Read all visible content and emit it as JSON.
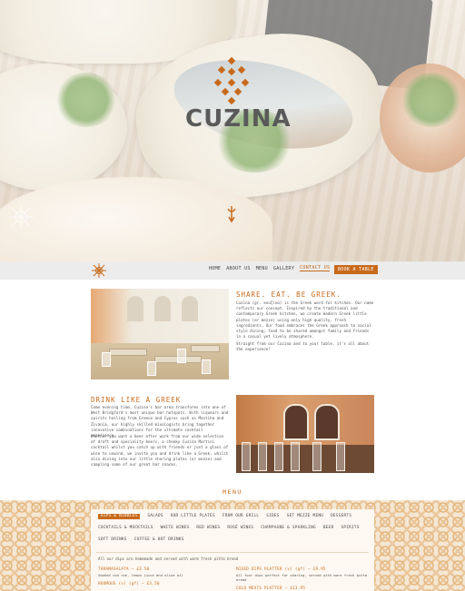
{
  "hero": {
    "brand": "CUZINA"
  },
  "nav": {
    "items": [
      "HOME",
      "ABOUT US",
      "MENU",
      "GALLERY",
      "CONTACT US"
    ],
    "active": "CONTACT US",
    "book_button": "BOOK A TABLE"
  },
  "about": {
    "title": "SHARE. EAT. BE GREEK.",
    "p1": "Cuzina (gr. κουζίνα) is the Greek word for kitchen. Our name reflects our concept. Inspired by the traditional and contemporary Greek kitchen, we create modern Greek little plates (or mezze) using only high quality, fresh ingredients. Our food embraces the Greek approach to social style dining; food to be shared amongst family and friends in a casual yet lively atmosphere.",
    "p2": "Straight from our Cuzina and to your table, it's all about the experience!"
  },
  "drink": {
    "title": "DRINK LIKE A GREEK",
    "p1": "Come evening time, Cuzina's bar area transforms into one of West Bridgford's most unique bar hotspots. With liqueurs and spirits hailing from Greece and Cyprus such as Mastiha and Zivania, our highly skilled mixologists bring together innovative combinations for the ultimate cocktail experience.",
    "p2": "Whether you want a beer after work from our wide selection of draft and speciality beers, a cheeky Cuzina Martini cocktail whilst you catch up with friends or just a glass of wine to unwind, we invite you and drink like a Greek, whilst also diving into our little sharing plates (or mezze) and sampling some of our great bar snacks."
  },
  "menu": {
    "heading": "MENU",
    "tabs": [
      "DIPS & NIBBLES",
      "SALADS",
      "OUR LITTLE PLATES",
      "FROM OUR GRILL",
      "SIDES",
      "SET MEZZE MENU",
      "DESSERTS",
      "COCKTAILS & MOCKTAILS",
      "WHITE WINES",
      "RED WINES",
      "ROSÉ WINES",
      "CHAMPAGNE & SPARKLING",
      "BEER",
      "SPIRITS",
      "SOFT DRINKS",
      "COFFEE & HOT DRINKS"
    ],
    "active_tab": "DIPS & NIBBLES",
    "note": "All our dips are homemade and served with warm fresh pitta bread",
    "items": [
      {
        "name": "TARAMASALATA – £3.50",
        "desc": "Smoked cod roe, lemon juice and olive oil"
      },
      {
        "name": "HOUMOUS (v) (gf) – £3.50",
        "desc": ""
      },
      {
        "name": "MIXED DIPS PLATTER (v) (gf) – £9.95",
        "desc": "All four dips perfect for sharing, served with more fresh pitta bread"
      },
      {
        "name": "COLD MEATS PLATTER – £13.95",
        "desc": ""
      }
    ]
  }
}
